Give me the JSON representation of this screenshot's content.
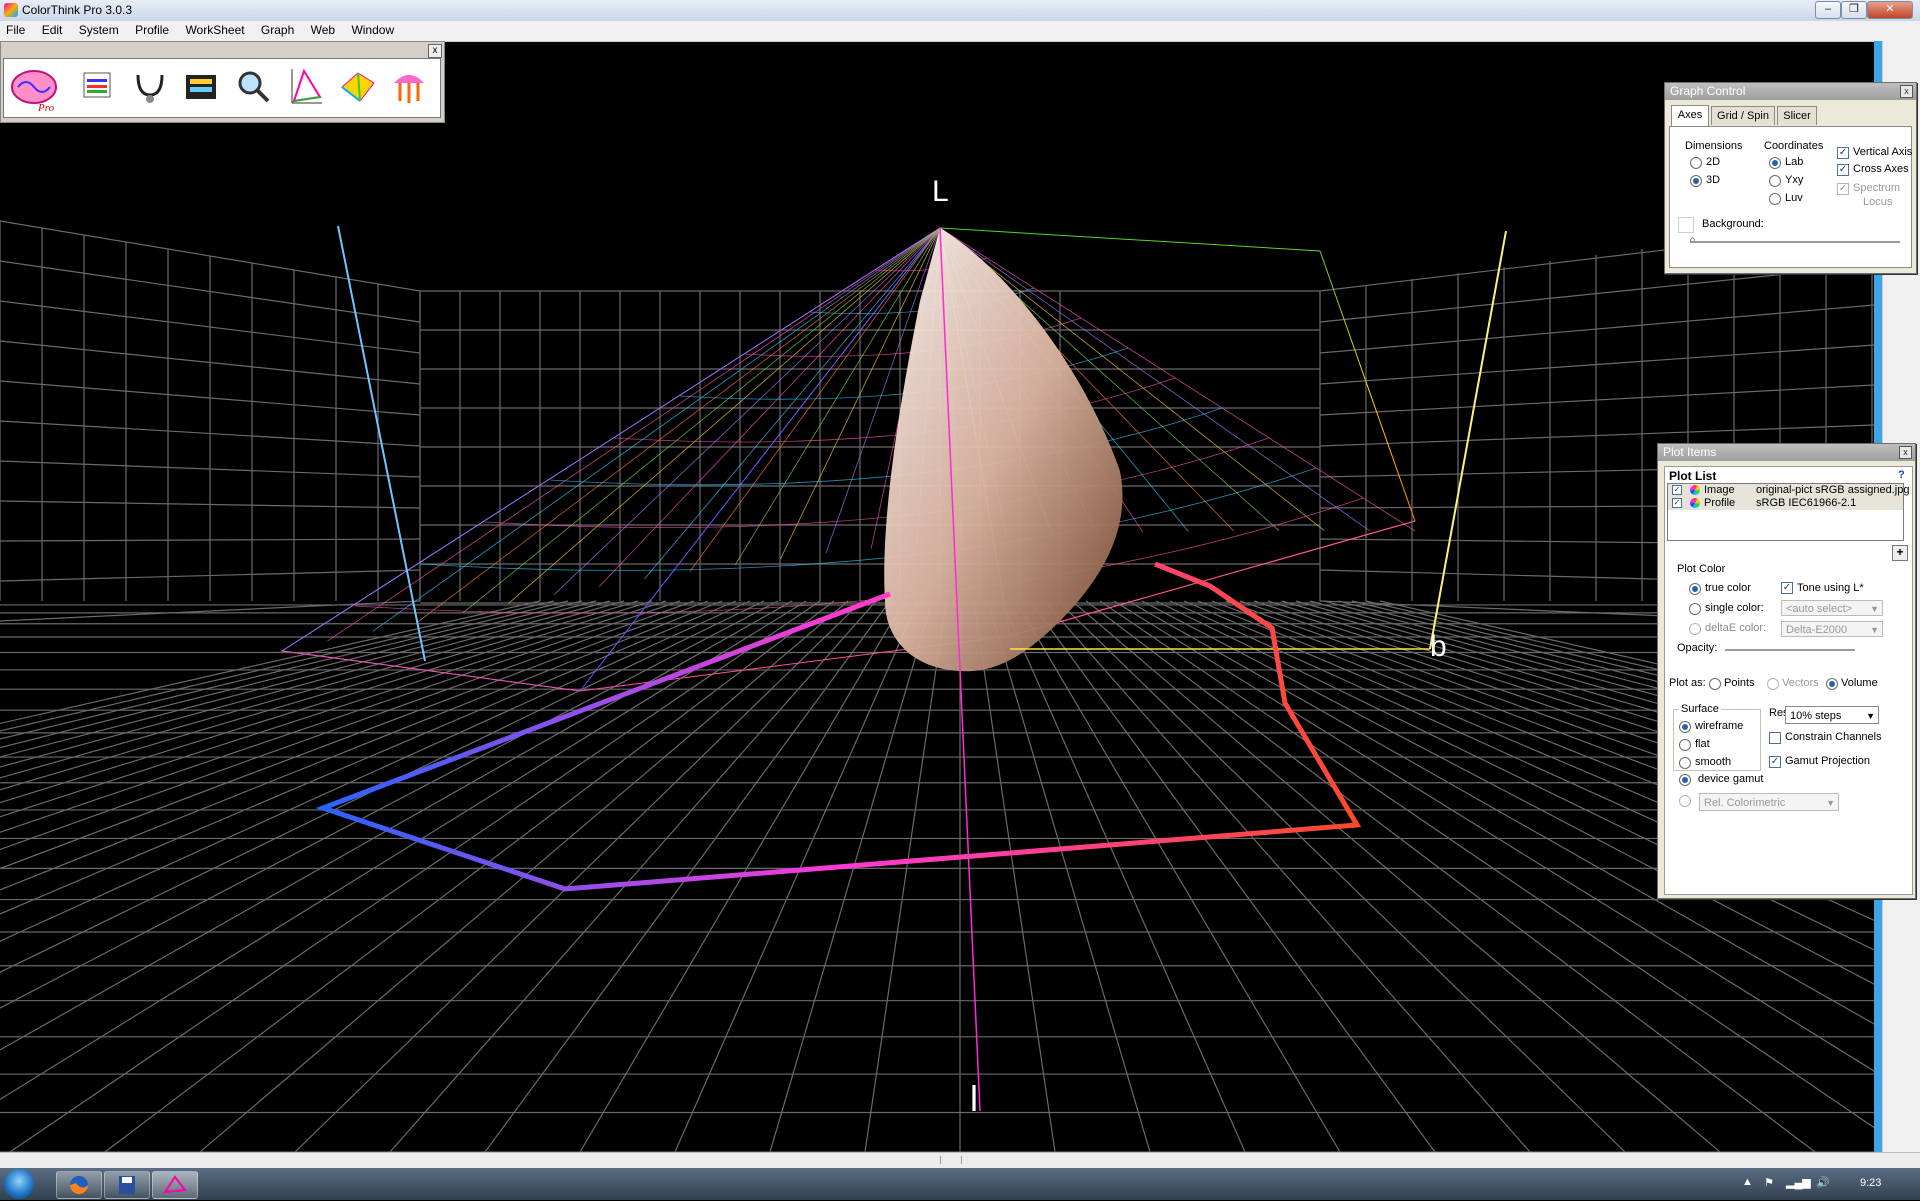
{
  "window": {
    "title": "ColorThink Pro 3.0.3",
    "controls": [
      "–",
      "❐",
      "✕"
    ]
  },
  "menu": [
    "File",
    "Edit",
    "System",
    "Profile",
    "WorkSheet",
    "Graph",
    "Web",
    "Window"
  ],
  "toolbar": {
    "close_label": "x",
    "tools": [
      "brain-logo-icon",
      "worksheet-icon",
      "profile-inspector-icon",
      "color-list-icon",
      "search-icon",
      "gamut-icon",
      "grapher-icon",
      "color-wheel-icon"
    ]
  },
  "graph": {
    "axis_l_label": "L",
    "axis_b_label": "b",
    "axis_a_label": "l"
  },
  "graph_control": {
    "title": "Graph Control",
    "tabs": [
      "Axes",
      "Grid / Spin",
      "Slicer"
    ],
    "active_tab": "Axes",
    "dimensions_title": "Dimensions",
    "dimensions": [
      {
        "label": "2D",
        "selected": false
      },
      {
        "label": "3D",
        "selected": true
      }
    ],
    "coordinates_title": "Coordinates",
    "coordinates": [
      {
        "label": "Lab",
        "selected": true
      },
      {
        "label": "Yxy",
        "selected": false
      },
      {
        "label": "Luv",
        "selected": false
      }
    ],
    "vertical_axis": "Vertical Axis",
    "cross_axes": "Cross Axes",
    "spectrum_locus_1": "Spectrum",
    "spectrum_locus_2": "Locus",
    "background_label": "Background:",
    "slider_tick": "0"
  },
  "plot_items": {
    "title": "Plot Items",
    "list_title": "Plot List",
    "help_label": "?",
    "add_label": "+",
    "rows": [
      {
        "type": "Image",
        "name": "original-pict sRGB assigned.jpg"
      },
      {
        "type": "Profile",
        "name": "sRGB IEC61966-2.1"
      }
    ],
    "plot_color_title": "Plot Color",
    "true_color": "true color",
    "tone_using": "Tone using L*",
    "single_color": "single color:",
    "single_color_value": "<auto select>",
    "delta_e_color": "deltaE color:",
    "delta_e_value": "Delta-E2000",
    "opacity_label": "Opacity:",
    "plot_as_label": "Plot as:",
    "plot_as": [
      "Points",
      "Vectors",
      "Volume"
    ],
    "surface_title": "Surface",
    "surface": [
      "wireframe",
      "flat",
      "smooth"
    ],
    "res_label": "Res:",
    "res_value": "10% steps",
    "constrain_channels": "Constrain Channels",
    "gamut_projection": "Gamut Projection",
    "device_gamut": "device gamut",
    "rendering_intent": "Rel. Colorimetric"
  },
  "taskbar": {
    "clock": "9:23"
  }
}
